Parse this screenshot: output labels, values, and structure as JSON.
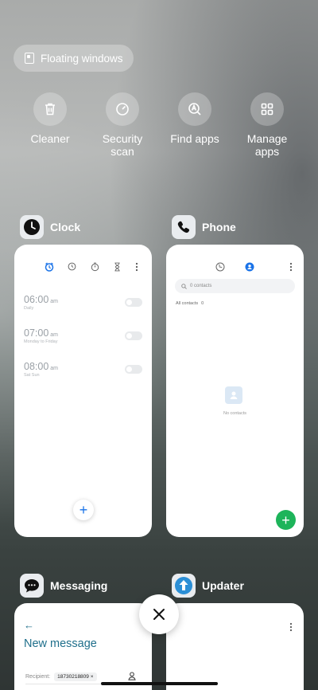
{
  "floating_windows": {
    "label": "Floating windows",
    "icon": "floating-window-icon"
  },
  "quick_actions": [
    {
      "label": "Cleaner",
      "icon": "trash-icon"
    },
    {
      "label": "Security\nscan",
      "icon": "security-gauge-icon"
    },
    {
      "label": "Find apps",
      "icon": "search-app-icon"
    },
    {
      "label": "Manage\napps",
      "icon": "grid-icon"
    }
  ],
  "recent_apps": {
    "clock": {
      "title": "Clock",
      "alarms": [
        {
          "time": "06:00",
          "ampm": "am",
          "repeat": "Daily"
        },
        {
          "time": "07:00",
          "ampm": "am",
          "repeat": "Monday to Friday"
        },
        {
          "time": "08:00",
          "ampm": "am",
          "repeat": "Sat Sun"
        }
      ]
    },
    "phone": {
      "title": "Phone",
      "search_placeholder": "0 contacts",
      "all_contacts": "All contacts",
      "all_contacts_count": "0",
      "empty_label": "No contacts"
    },
    "messaging": {
      "title": "Messaging",
      "heading": "New message",
      "recipient_label": "Recipient:",
      "recipient_value": "18730218809"
    },
    "updater": {
      "title": "Updater"
    }
  },
  "colors": {
    "accent_blue": "#1a73e8",
    "phone_green": "#1db45a",
    "messaging_teal": "#1f6f8b"
  }
}
